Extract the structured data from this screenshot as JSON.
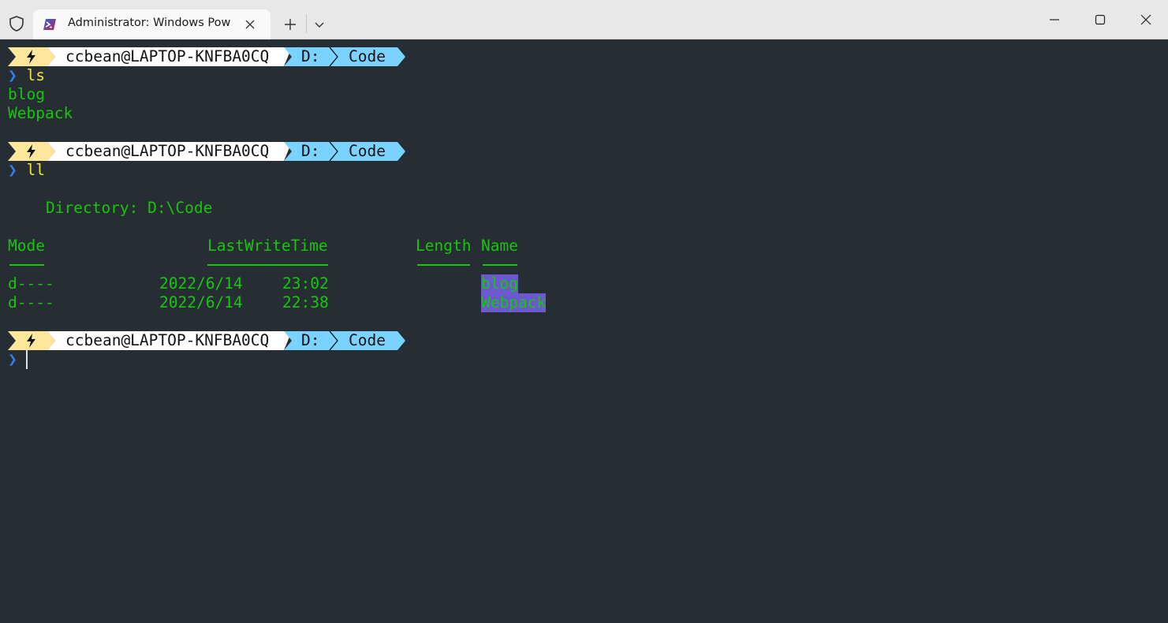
{
  "window": {
    "tab_title": "Administrator: Windows PowerShell",
    "colors": {
      "titlebar": "#e8e8e8",
      "terminal_bg": "#272e33",
      "text_green": "#16c60c",
      "prompt_yellow": "#fee79b",
      "prompt_blue": "#79d2ff",
      "selection": "#6a5acd"
    },
    "icons": [
      "shield-icon",
      "powershell-icon",
      "close-icon",
      "plus-icon",
      "chevron-down-icon",
      "minimize-icon",
      "maximize-icon",
      "window-close-icon"
    ]
  },
  "prompt": {
    "user_host": "ccbean@LAPTOP-KNFBA0CQ",
    "drive": "D:",
    "dir": "Code",
    "chevron": "❯"
  },
  "session": {
    "cmd1": "ls",
    "ls_output": [
      "blog",
      "Webpack"
    ],
    "cmd2": "ll",
    "directory_line": "Directory: D:\\Code",
    "headers": {
      "mode": "Mode",
      "lastwrite": "LastWriteTime",
      "length": "Length",
      "name": "Name"
    },
    "rows": [
      {
        "mode": "d----",
        "date": "2022/6/14",
        "time": "23:02",
        "name": "blog"
      },
      {
        "mode": "d----",
        "date": "2022/6/14",
        "time": "22:38",
        "name": "Webpack"
      }
    ]
  }
}
